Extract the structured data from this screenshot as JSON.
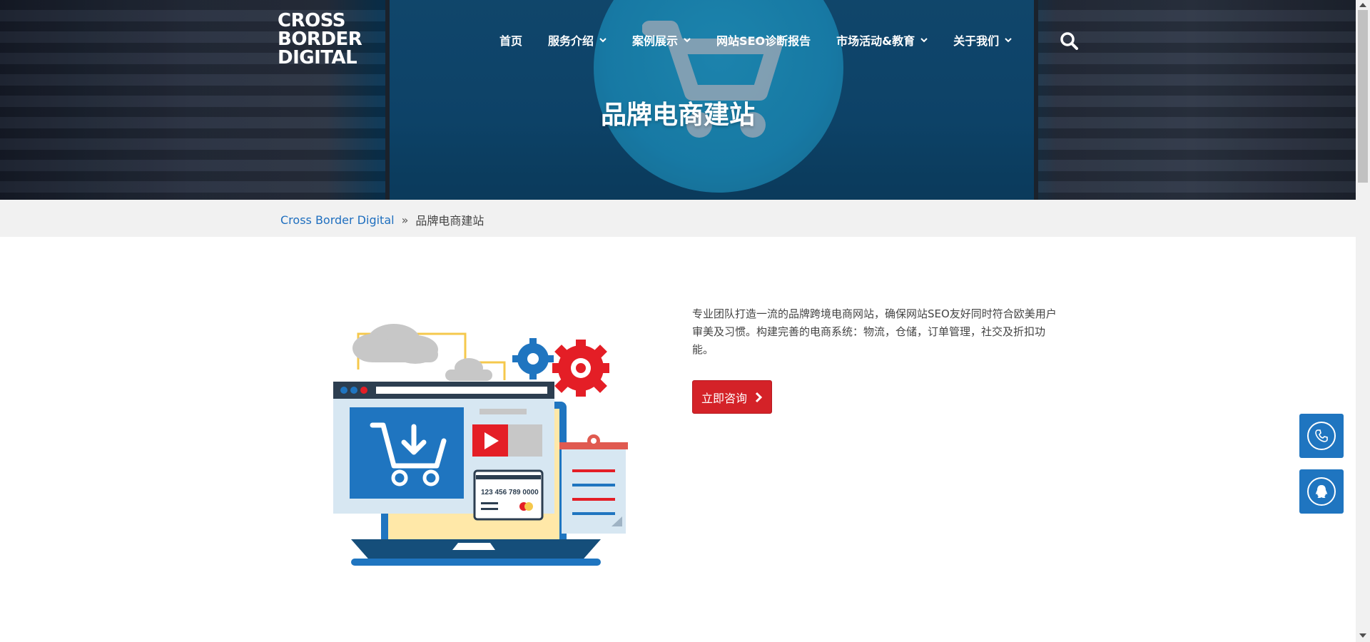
{
  "logo": {
    "line1": "CROSS",
    "line2": "BORDER",
    "line3": "DIGITAL"
  },
  "nav": {
    "items": [
      {
        "label": "首页",
        "has_dropdown": false
      },
      {
        "label": "服务介绍",
        "has_dropdown": true
      },
      {
        "label": "案例展示",
        "has_dropdown": true
      },
      {
        "label": "网站SEO诊断报告",
        "has_dropdown": false
      },
      {
        "label": "市场活动&教育",
        "has_dropdown": true
      },
      {
        "label": "关于我们",
        "has_dropdown": true
      }
    ],
    "search_icon": "search-icon"
  },
  "hero": {
    "title": "品牌电商建站"
  },
  "breadcrumb": {
    "home": "Cross Border Digital",
    "separator": "»",
    "current": "品牌电商建站"
  },
  "content": {
    "description": "专业团队打造一流的品牌跨境电商网站，确保网站SEO友好同时符合欧美用户审美及习惯。构建完善的电商系统：物流，仓储，订单管理，社交及折扣功能。",
    "cta_label": "立即咨询",
    "card_number": "123 456 789 0000"
  },
  "floating": {
    "phone_icon": "phone-icon",
    "qq_icon": "qq-icon"
  },
  "colors": {
    "accent_red": "#d42228",
    "brand_blue": "#1f75c0",
    "link_blue": "#1f6fbf"
  }
}
